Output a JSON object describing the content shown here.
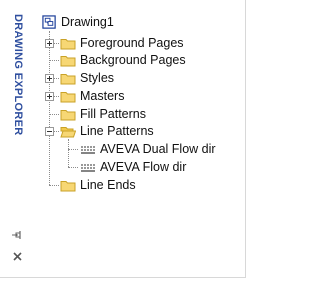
{
  "panel": {
    "title": "DRAWING EXPLORER",
    "pin_icon": "pin-icon",
    "close_icon": "close-icon"
  },
  "tree": {
    "root": {
      "label": "Drawing1",
      "icon": "drawing-icon"
    },
    "items": [
      {
        "label": "Foreground Pages",
        "icon": "folder-icon",
        "expandable": true
      },
      {
        "label": "Background Pages",
        "icon": "folder-icon",
        "expandable": false
      },
      {
        "label": "Styles",
        "icon": "folder-icon",
        "expandable": true
      },
      {
        "label": "Masters",
        "icon": "folder-icon",
        "expandable": true
      },
      {
        "label": "Fill Patterns",
        "icon": "folder-icon",
        "expandable": false
      },
      {
        "label": "Line Patterns",
        "icon": "open-folder-icon",
        "expandable": true,
        "expanded": true,
        "children": [
          {
            "label": "AVEVA Dual Flow dir",
            "icon": "line-pattern-icon"
          },
          {
            "label": "AVEVA Flow dir",
            "icon": "line-pattern-icon"
          }
        ]
      },
      {
        "label": "Line Ends",
        "icon": "folder-icon",
        "expandable": false
      }
    ]
  },
  "colors": {
    "title": "#2f4f9f",
    "folder_fill": "#f7d774",
    "folder_stroke": "#c9a227",
    "connector": "#8c8c8c"
  }
}
